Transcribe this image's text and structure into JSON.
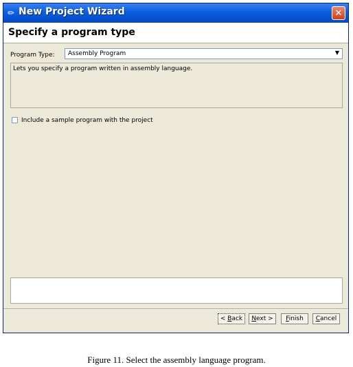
{
  "window": {
    "title": "New Project Wizard",
    "close_label": "✕"
  },
  "header": {
    "page_title": "Specify a program type"
  },
  "form": {
    "program_type_label": "Program Type:",
    "program_type_value": "Assembly Program",
    "description": "Lets you specify a program written in assembly language.",
    "include_sample_label": "Include a sample program with the project",
    "include_sample_checked": false
  },
  "buttons": {
    "back": {
      "prefix": "< ",
      "mnemonic": "B",
      "rest": "ack"
    },
    "next": {
      "mnemonic": "N",
      "rest": "ext >"
    },
    "finish": {
      "mnemonic": "F",
      "rest": "inish"
    },
    "cancel": {
      "mnemonic": "C",
      "rest": "ancel"
    }
  },
  "caption": "Figure 11. Select the assembly language program.",
  "colors": {
    "dialog_bg": "#ece9d8",
    "titlebar": "#0a5fe0",
    "close": "#c54320"
  },
  "icons": {
    "title": "pencil-icon",
    "dropdown": "chevron-down-icon"
  }
}
